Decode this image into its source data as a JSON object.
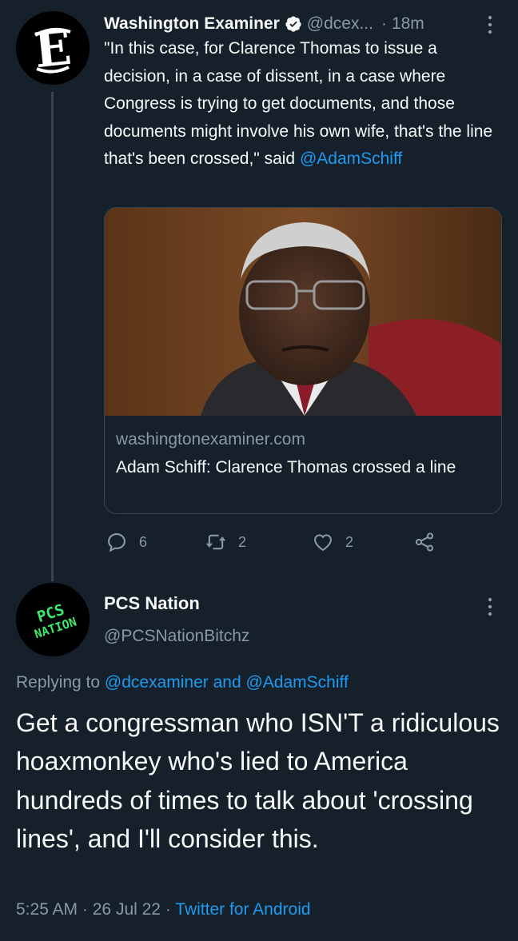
{
  "tweet1": {
    "author_name": "Washington Examiner",
    "handle": "@dcex...",
    "separator": "·",
    "time": "18m",
    "text_main": "\"In this case, for Clarence Thomas to issue a decision, in a case of dissent, in a case where Congress is trying to get documents, and those documents might involve his own wife, that's the line that's been crossed,\" said ",
    "text_mention": "@AdamSchiff",
    "avatar_icon": "washington-examiner-logo-icon",
    "verified_color": "#1d9bf0",
    "card": {
      "domain": "washingtonexaminer.com",
      "title": "Adam Schiff: Clarence Thomas crossed a line"
    },
    "actions": {
      "replies": "6",
      "retweets": "2",
      "likes": "2"
    }
  },
  "tweet2": {
    "author_name": "PCS Nation",
    "handle": "@PCSNationBitchz",
    "avatar_text_line1": "PCS",
    "avatar_text_line2": "NATION",
    "avatar_color": "#3ee86b",
    "replying_prefix": "Replying to",
    "replying_to": "@dcexaminer and @AdamSchiff",
    "text": "Get a congressman who ISN'T a ridiculous hoaxmonkey who's lied to America hundreds of times to talk about 'crossing lines', and I'll consider this.",
    "time": "5:25 AM",
    "separator1": "·",
    "date": "26 Jul 22",
    "separator2": "·",
    "source": "Twitter for Android"
  },
  "colors": {
    "background": "#15202b",
    "text": "#f7f9f9",
    "muted": "#8b98a5",
    "link": "#1d9bf0",
    "border": "#38444d"
  }
}
